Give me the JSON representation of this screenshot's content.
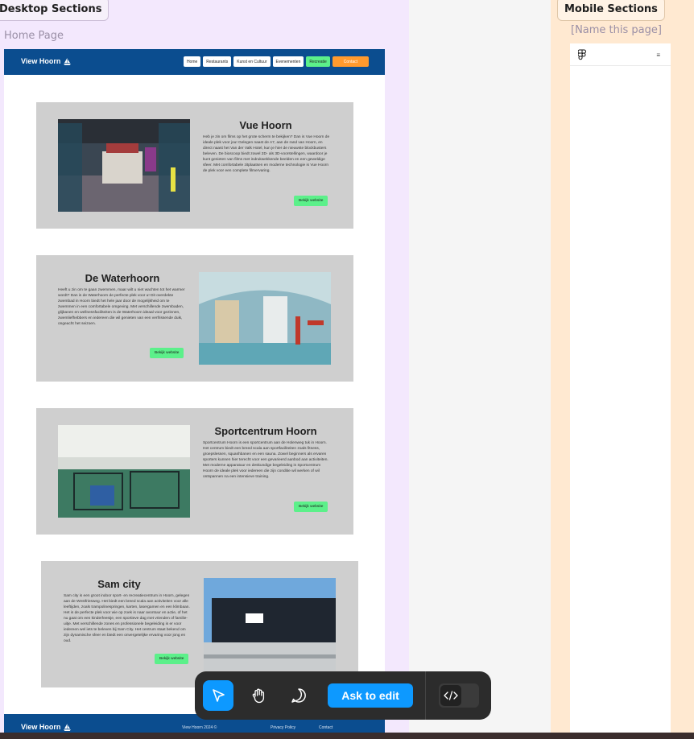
{
  "desktop": {
    "section_label": "Desktop Sections",
    "page_name": "Home Page"
  },
  "site": {
    "brand": "View Hoorn",
    "nav": [
      "Home",
      "Restaurants",
      "Kunst en Cultuur",
      "Evenementen",
      "Recreatie",
      "Contact"
    ],
    "cards": [
      {
        "title": "Vue Hoorn",
        "body": "Heb je zin om films op het grote scherm te bekijken? Dan is Vue Hoorn de ideale plek voor jou! Gelegen naast de A7, aan de rand van Hoorn, en direct naast het Van der Valk Hotel, kun je hier de nieuwste blockbusters beleven. De bioscoop biedt zowel 2D- als 3D-voorstellingen, waardoor je kunt genieten van films met indrukwekkende beelden en een geweldige sfeer. Met comfortabele zitplaatsen en moderne technologie is Vue Hoorn de plek voor een complete filmervaring.",
        "button": "Bekijk website",
        "image": "cinema-lobby-photo"
      },
      {
        "title": "De Waterhoorn",
        "body": "Heeft u zin om te gaan zwemmen, maar wilt u niet wachten tot het warmer wordt? Dan is de Waterhoorn de perfecte plek voor u! Dit overdekte zwembad in Hoorn biedt het hele jaar door de mogelijkheid om te zwemmen in een comfortabele omgeving. Met verschillende zwembaden, glijbanen en wellnessfaciliteiten is de Waterhoorn ideaal voor gezinnen, zwemliefhebbers en iedereen die wil genieten van een verfrissende duik, ongeacht het seizoen.",
        "button": "Bekijk website",
        "image": "indoor-pool-photo"
      },
      {
        "title": "Sportcentrum Hoorn",
        "body": "Sportcentrum Hoorn is een sportcentrum aan de Holenweg tuk in Hoorn. Het centrum biedt een breed scala aan sportfaciliteiten zoals fitness, groepslessen, squashbanen en een sauna. Zowel beginners als ervaren sporters kunnen hier terecht voor een gevarieerd aanbod aan activiteiten. Met moderne apparatuur en deskundige begeleiding is Sportcentrum Hoorn de ideale plek voor iedereen die zijn conditie wil werken of wil ontspannen na een intensieve training.",
        "button": "Bekijk website",
        "image": "padel-courts-photo"
      },
      {
        "title": "Sam city",
        "body": "Sam city is een groot indoor sport- en recreatiecentrum in Hoorn, gelegen aan de Westfriesweg. Het biedt een breed scala aan activiteiten voor alle leeftijden, zoals trampolinespringen, karten, lasergamen en een klimbaan. Het is de perfecte plek voor wie op zoek is naar avontuur en actie, of het nu gaat om een kinderfeestje, een sportieve dag met vrienden of familie-uitje. Met verschillende zones en professionele begeleiding is er voor iedereen wel iets te beleven bij Sam City. Het centrum staat bekend om zijn dynamische sfeer en biedt een onvergetelijke ervaring voor jong en oud.",
        "button": "Bekijk website",
        "image": "samcity-building-photo"
      }
    ],
    "footer": {
      "brand": "View Hoorn",
      "copyright": "View Hoorn 2024 ©",
      "privacy": "Privacy Policy",
      "contact": "Contact"
    }
  },
  "mobile": {
    "section_label": "Mobile Sections",
    "page_name": "[Name this page]"
  },
  "toolbar": {
    "ask_label": "Ask to edit",
    "tools": [
      "move-tool",
      "hand-tool",
      "comment-tool"
    ]
  },
  "colors": {
    "nav_blue": "#0b4d8f",
    "accent_green": "#5cf08a",
    "accent_orange": "#ff9a2e",
    "card_grey": "#cfcfcf",
    "figma_blue": "#0d99ff"
  }
}
